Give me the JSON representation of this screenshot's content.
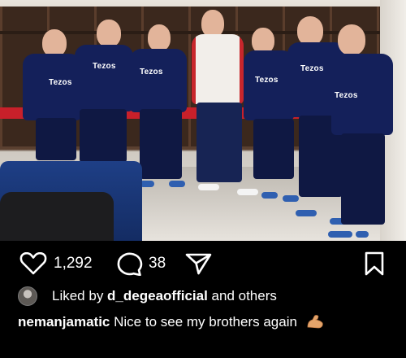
{
  "post": {
    "photo_description_sponsor": "Tezos",
    "actions": {
      "like_count": "1,292",
      "comment_count": "38"
    },
    "icons": {
      "like": "heart-icon",
      "comment": "comment-icon",
      "share": "send-icon",
      "save": "bookmark-icon"
    },
    "liked_by": {
      "prefix": "Liked by ",
      "user": "d_degeaofficial",
      "suffix": " and others"
    },
    "caption": {
      "author": "nemanjamatic",
      "text": " Nice to see my brothers again",
      "emoji": "flexed-biceps-emoji"
    }
  },
  "colors": {
    "background": "#000000",
    "text": "#ffffff",
    "kit_navy": "#14205a"
  }
}
